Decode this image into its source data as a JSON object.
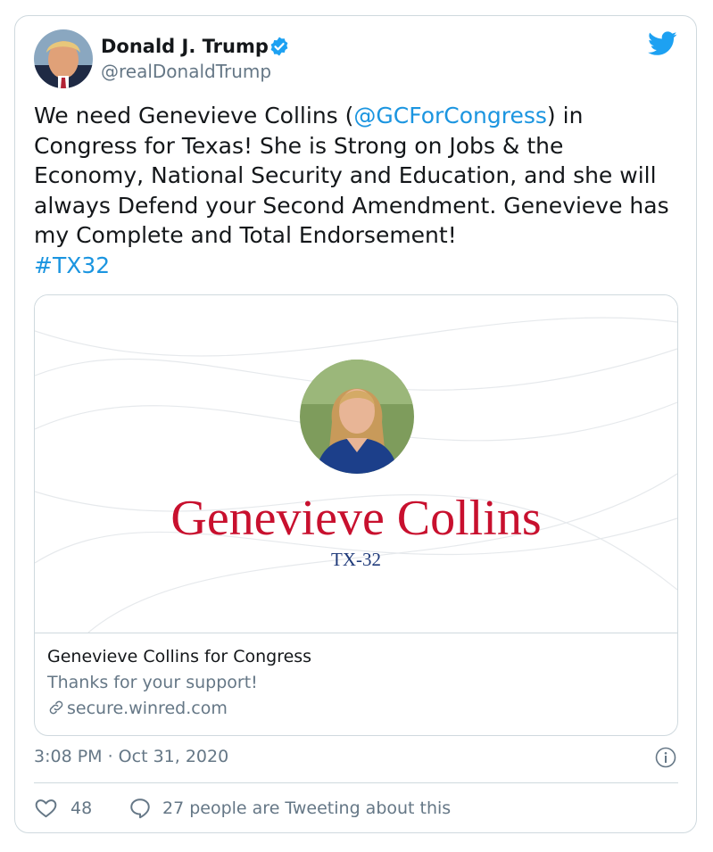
{
  "tweet": {
    "author_name": "Donald J. Trump",
    "author_handle": "@realDonaldTrump",
    "text_before_mention": "We need Genevieve Collins (",
    "mention": "@GCForCongress",
    "text_after_mention": ") in Congress for Texas! She is Strong on Jobs & the Economy, National Security and Education, and she will always Defend your Second Amendment. Genevieve has my Complete and Total Endorsement!\n",
    "hashtag": "#TX32",
    "timestamp": "3:08 PM · Oct 31, 2020"
  },
  "link_card": {
    "image_name": "Genevieve Collins",
    "image_district": "TX-32",
    "title": "Genevieve Collins for Congress",
    "description": "Thanks for your support!",
    "url": "secure.winred.com"
  },
  "actions": {
    "likes": "48",
    "conversation": "27 people are Tweeting about this"
  },
  "icons": {
    "verified": "verified-badge-icon",
    "brand": "twitter-bird-icon",
    "info": "info-icon",
    "like": "heart-icon",
    "reply": "speech-bubble-icon",
    "link": "link-icon"
  },
  "colors": {
    "accent": "#1da1f2",
    "link": "#1b95e0",
    "candidate_red": "#c8102e",
    "muted": "#657786",
    "border": "#cfd9de"
  }
}
